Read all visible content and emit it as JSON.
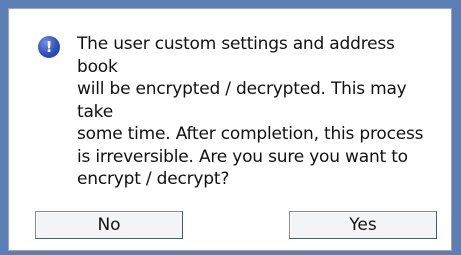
{
  "dialog": {
    "icon": "info-icon",
    "icon_glyph": "!",
    "message": "The user custom settings and address book\nwill be encrypted / decrypted. This may take\nsome time. After completion, this process\nis irreversible. Are you sure you want to\nencrypt / decrypt?",
    "buttons": {
      "no_label": "No",
      "yes_label": "Yes"
    }
  },
  "colors": {
    "frame": "#5b7fb4",
    "icon": "#3150b8"
  }
}
